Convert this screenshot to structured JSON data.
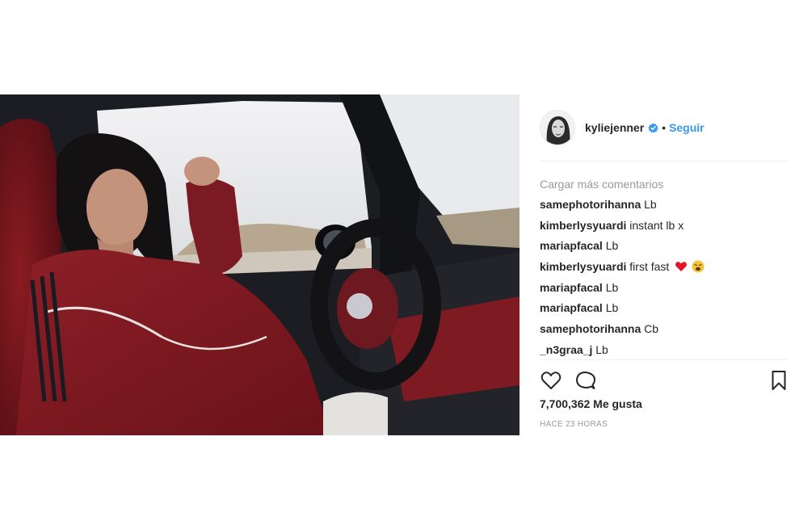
{
  "post": {
    "username": "kyliejenner",
    "separator": "•",
    "follow_label": "Seguir",
    "load_more_label": "Cargar más comentarios",
    "comments": [
      {
        "user": "samephotorihanna",
        "text": "Lb"
      },
      {
        "user": "kimberlysyuardi",
        "text": "instant lb x"
      },
      {
        "user": "mariapfacal",
        "text": "Lb"
      },
      {
        "user": "kimberlysyuardi",
        "text": "first fast",
        "emojis": [
          "red-heart",
          "weary-face"
        ]
      },
      {
        "user": "mariapfacal",
        "text": "Lb"
      },
      {
        "user": "mariapfacal",
        "text": "Lb"
      },
      {
        "user": "samephotorihanna",
        "text": "Cb"
      },
      {
        "user": "_n3graa_j",
        "text": "Lb"
      }
    ],
    "likes_text": "7,700,362 Me gusta",
    "timestamp": "HACE 23 HORAS",
    "icons": {
      "like": "heart-outline-icon",
      "comment": "speech-bubble-icon",
      "save": "bookmark-icon",
      "verified": "verified-badge-icon"
    },
    "colors": {
      "accent": "#3897f0",
      "muted": "#999999",
      "text": "#262626",
      "divider": "#efefef"
    }
  }
}
